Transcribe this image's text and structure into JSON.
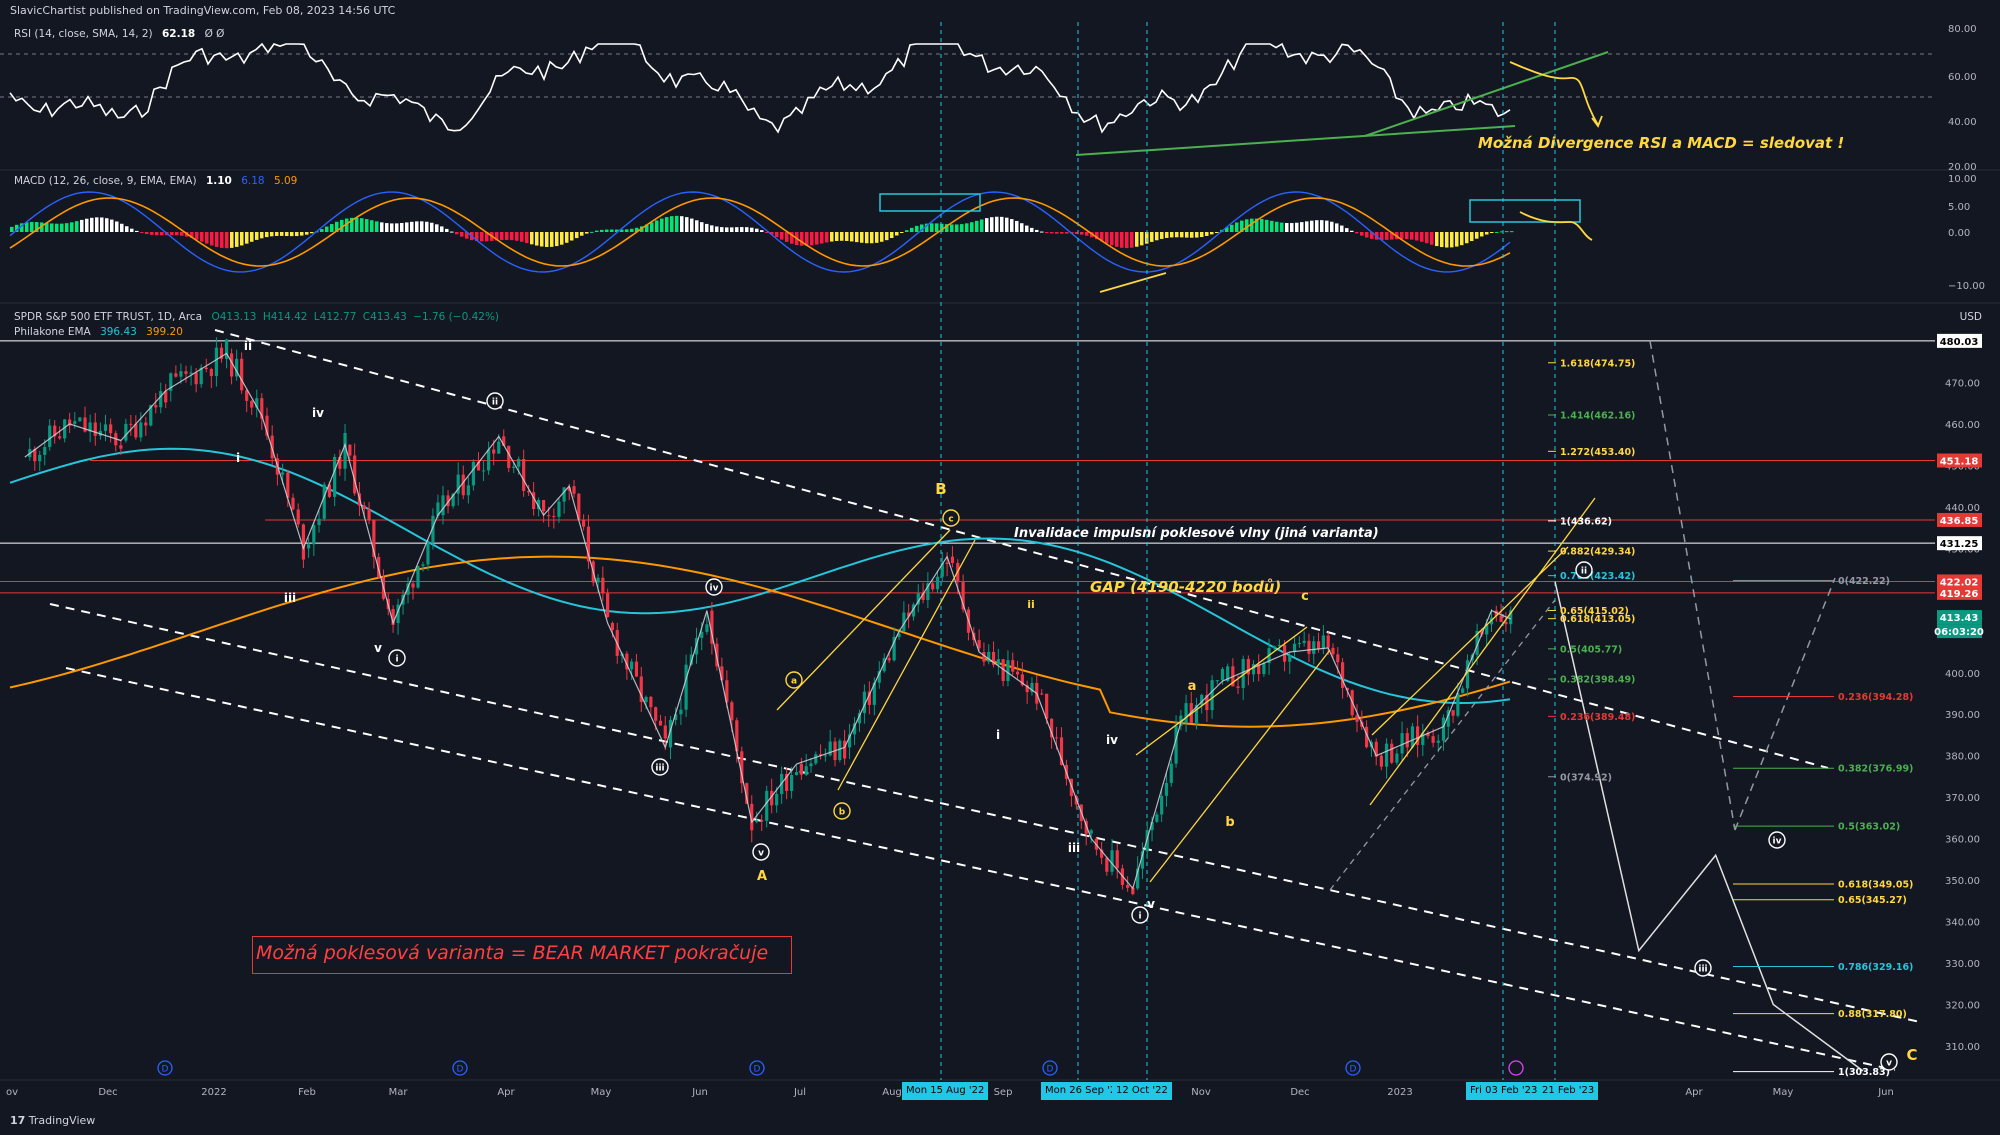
{
  "header": {
    "text": "SlavicChartist published on TradingView.com, Feb 08, 2023 14:56 UTC"
  },
  "rsi": {
    "label": "RSI (14, close, SMA, 14, 2)",
    "value": "62.18",
    "extra": "Ø Ø",
    "axis": [
      "80.00",
      "60.00",
      "40.00",
      "20.00"
    ]
  },
  "macd": {
    "label": "MACD (12, 26, close, 9, EMA, EMA)",
    "v1": "1.10",
    "v2": "6.18",
    "v3": "5.09",
    "axis": [
      "10.00",
      "5.00",
      "0.00",
      "−10.00"
    ]
  },
  "main": {
    "title": "SPDR S&P 500 ETF TRUST, 1D, Arca",
    "o": "O413.13",
    "h": "H414.42",
    "l": "L412.77",
    "c": "C413.43",
    "chg": "−1.76 (−0.42%)",
    "ema_label": "Philakone EMA",
    "ema1": "396.43",
    "ema2": "399.20",
    "currency": "USD",
    "axis": [
      "470.00",
      "460.00",
      "450.00",
      "440.00",
      "430.00",
      "420.00",
      "410.00",
      "400.00",
      "390.00",
      "380.00",
      "370.00",
      "360.00",
      "350.00",
      "340.00",
      "330.00",
      "320.00",
      "310.00"
    ]
  },
  "price_tags": [
    {
      "text": "480.03",
      "color": "#ffffff",
      "bg": "#ffffff"
    },
    {
      "text": "451.18",
      "color": "#ffffff",
      "bg": "#e53935"
    },
    {
      "text": "436.85",
      "color": "#ffffff",
      "bg": "#e53935"
    },
    {
      "text": "431.25",
      "color": "#ffffff",
      "bg": "#ffffff"
    },
    {
      "text": "422.02",
      "color": "#ffffff",
      "bg": "#e53935"
    },
    {
      "text": "419.26",
      "color": "#ffffff",
      "bg": "#e53935"
    },
    {
      "text": "413.43",
      "color": "#ffffff",
      "bg": "#089981"
    },
    {
      "text": "06:03:20",
      "color": "#ffffff",
      "bg": "#089981"
    }
  ],
  "time_axis": [
    "ov",
    "Dec",
    "2022",
    "Feb",
    "Mar",
    "Apr",
    "May",
    "Jun",
    "Jul",
    "Aug",
    "Sep",
    "Nov",
    "Dec",
    "2023",
    "Apr",
    "May",
    "Jun"
  ],
  "date_labels": [
    "Mon 15 Aug '22",
    "Mon 26 Sep '22",
    "12 Oct '22",
    "Fri 03 Feb '23",
    "21 Feb '23"
  ],
  "annotations": {
    "bear": "Možná poklesová varianta = BEAR MARKET pokračuje",
    "divergence": "Možná Divergence RSI a MACD = sledovat !",
    "gap": "GAP (4190-4220 bodů)",
    "invalidation": "Invalidace impulsní poklesové vlny (jiná varianta)"
  },
  "fib_up": [
    {
      "t": "1.618(474.75)",
      "c": "#ffd740"
    },
    {
      "t": "1.414(462.16)",
      "c": "#4caf50"
    },
    {
      "t": "1.272(453.40)",
      "c": "#ffd740"
    },
    {
      "t": "1(436.62)",
      "c": "#ffffff"
    },
    {
      "t": "0.882(429.34)",
      "c": "#ffd740"
    },
    {
      "t": "0.786(423.42)",
      "c": "#26c6da"
    },
    {
      "t": "0.65(415.02)",
      "c": "#ffd740"
    },
    {
      "t": "0.618(413.05)",
      "c": "#ffd740"
    },
    {
      "t": "0.5(405.77)",
      "c": "#4caf50"
    },
    {
      "t": "0.382(398.49)",
      "c": "#4caf50"
    },
    {
      "t": "0.236(389.48)",
      "c": "#e53935"
    },
    {
      "t": "0(374.92)",
      "c": "#9598a1"
    }
  ],
  "fib_down": [
    {
      "t": "0(422.22)",
      "c": "#9598a1"
    },
    {
      "t": "0.236(394.28)",
      "c": "#e53935"
    },
    {
      "t": "0.382(376.99)",
      "c": "#4caf50"
    },
    {
      "t": "0.5(363.02)",
      "c": "#4caf50"
    },
    {
      "t": "0.618(349.05)",
      "c": "#ffd740"
    },
    {
      "t": "0.65(345.27)",
      "c": "#ffd740"
    },
    {
      "t": "0.786(329.16)",
      "c": "#26c6da"
    },
    {
      "t": "0.88(317.80)",
      "c": "#ffd740"
    },
    {
      "t": "1(303.83)",
      "c": "#ffffff"
    }
  ],
  "wave_labels": [
    "ii",
    "iv",
    "i",
    "iii",
    "v",
    "i",
    "ii",
    "iii",
    "iv",
    "v",
    "A",
    "a",
    "b",
    "c",
    "B",
    "ii",
    "i",
    "iv",
    "iii",
    "v",
    "i",
    "a",
    "b",
    "c",
    "ii",
    "iii",
    "iv",
    "v",
    "C"
  ],
  "chart_data": {
    "type": "line",
    "title": "SPDR S&P 500 ETF TRUST, 1D, Arca",
    "xlabel": "",
    "ylabel": "USD",
    "ylim": [
      300,
      482
    ],
    "series": [
      {
        "name": "SPDR S&P 500 ETF TRUST",
        "x": [
          "2021-11-01",
          "2021-11-15",
          "2021-12-01",
          "2021-12-15",
          "2022-01-03",
          "2022-01-14",
          "2022-01-27",
          "2022-02-09",
          "2022-02-24",
          "2022-03-10",
          "2022-03-29",
          "2022-04-12",
          "2022-04-20",
          "2022-05-02",
          "2022-05-20",
          "2022-06-02",
          "2022-06-16",
          "2022-06-30",
          "2022-07-15",
          "2022-08-01",
          "2022-08-16",
          "2022-08-26",
          "2022-09-13",
          "2022-09-30",
          "2022-10-13",
          "2022-10-28",
          "2022-11-10",
          "2022-12-01",
          "2022-12-13",
          "2022-12-28",
          "2023-01-18",
          "2023-02-02",
          "2023-02-08"
        ],
        "values": [
          452,
          460,
          456,
          468,
          477,
          462,
          430,
          455,
          412,
          438,
          457,
          438,
          445,
          412,
          382,
          415,
          364,
          378,
          382,
          410,
          428,
          405,
          395,
          360,
          348,
          388,
          398,
          405,
          406,
          380,
          387,
          415,
          413
        ]
      },
      {
        "name": "Philakone EMA",
        "values": [
          396.43
        ]
      },
      {
        "name": "Philakone EMA 2",
        "values": [
          399.2
        ]
      }
    ],
    "projection": {
      "x": [
        "2023-02-15",
        "2023-03-20",
        "2023-04-13",
        "2023-05-01",
        "2023-05-29"
      ],
      "values": [
        422,
        333,
        356,
        320,
        304
      ]
    }
  }
}
